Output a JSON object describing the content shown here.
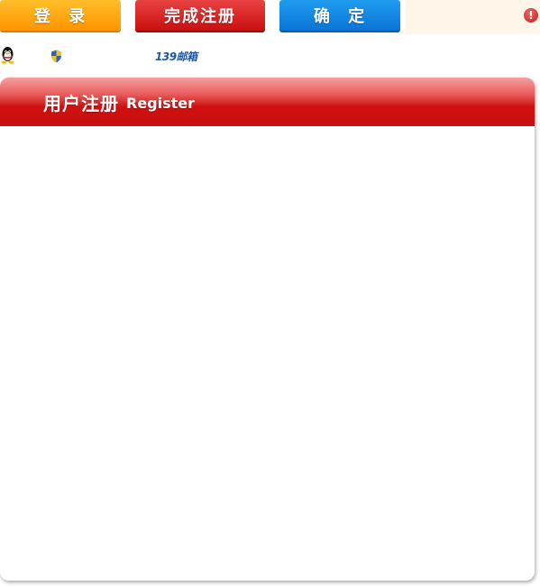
{
  "toolbar": {
    "login_label": "登 录",
    "finish_label": "完成注册",
    "confirm_label": "确 定"
  },
  "error": {
    "icon_char": "!"
  },
  "links": {
    "mail_logo": "139邮箱"
  },
  "panel": {
    "title": "用户注册",
    "subtitle": "Register"
  },
  "colors": {
    "login": "#ff9f10",
    "finish": "#d41a1a",
    "confirm": "#1187e2",
    "header": "#cf1010"
  }
}
